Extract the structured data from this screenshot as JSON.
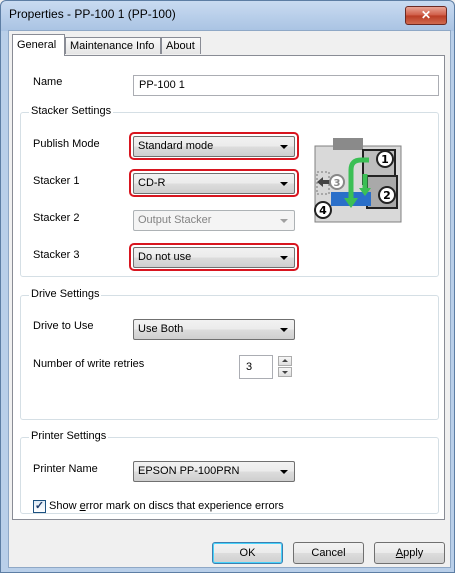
{
  "window": {
    "title": "Properties - PP-100 1 (PP-100)",
    "close_icon": "close-icon"
  },
  "tabs": [
    {
      "label": "General",
      "active": true
    },
    {
      "label": "Maintenance Info",
      "active": false
    },
    {
      "label": "About",
      "active": false
    }
  ],
  "general": {
    "name_label": "Name",
    "name_value": "PP-100 1"
  },
  "stacker_settings": {
    "title": "Stacker Settings",
    "publish_mode_label": "Publish Mode",
    "publish_mode_value": "Standard mode",
    "stacker1_label": "Stacker 1",
    "stacker1_value": "CD-R",
    "stacker2_label": "Stacker 2",
    "stacker2_value": "Output Stacker",
    "stacker3_label": "Stacker 3",
    "stacker3_value": "Do not use",
    "diagram_numbers": [
      "1",
      "2",
      "3",
      "4"
    ],
    "highlight_color": "#d8151f"
  },
  "drive_settings": {
    "title": "Drive Settings",
    "drive_label": "Drive to Use",
    "drive_value": "Use Both",
    "retries_label": "Number of write retries",
    "retries_value": "3"
  },
  "printer_settings": {
    "title": "Printer Settings",
    "printer_name_label": "Printer Name",
    "printer_name_value": "EPSON PP-100PRN",
    "show_error_pre": "Show ",
    "show_error_accel": "e",
    "show_error_post": "rror mark on discs that experience errors",
    "show_error_checked": true
  },
  "buttons": {
    "ok": "OK",
    "cancel": "Cancel",
    "apply_accel": "A",
    "apply_rest": "pply"
  }
}
